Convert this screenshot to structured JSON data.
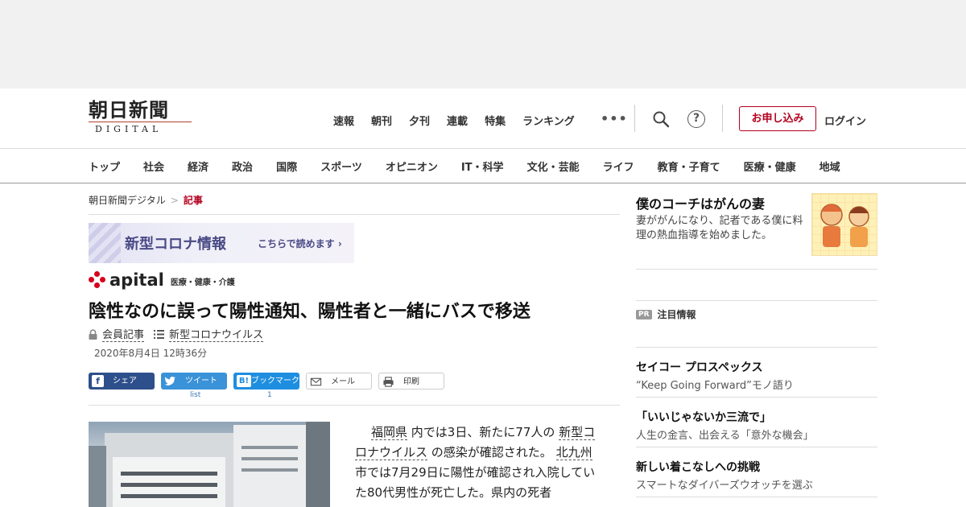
{
  "header": {
    "logo_main": "朝日新聞",
    "logo_sub": "DIGITAL",
    "nav": [
      "速報",
      "朝刊",
      "夕刊",
      "連載",
      "特集",
      "ランキング"
    ],
    "more": "•••",
    "help": "?",
    "apply_label": "お申し込み",
    "login_label": "ログイン",
    "accent_color": "#b3001e"
  },
  "categories": [
    "トップ",
    "社会",
    "経済",
    "政治",
    "国際",
    "スポーツ",
    "オピニオン",
    "IT・科学",
    "文化・芸能",
    "ライフ",
    "教育・子育て",
    "医療・健康",
    "地域"
  ],
  "breadcrumb": {
    "home": "朝日新聞デジタル",
    "sep": ">",
    "current": "記事"
  },
  "corona_banner": {
    "title": "新型コロナ情報",
    "sub": "こちらで読めます ›"
  },
  "apital": {
    "logo": "apital",
    "category": "医療・健康・介護"
  },
  "article": {
    "headline": "陰性なのに誤って陽性通知、陽性者と一緒にバスで移送",
    "tag_member": "会員記事",
    "tag_topic": "新型コロナウイルス",
    "date": "2020年8月4日 12時36分",
    "body_1": "福岡県",
    "body_2": "内では3日、新たに77人の",
    "body_3": "新型コロナウイルス",
    "body_4": "の感染が確認された。",
    "body_5": "北九州",
    "body_6": "市では7月29日に陽性が確認され入院していた80代男性が死亡した。県内の死者"
  },
  "share": {
    "facebook": "シェア",
    "twitter": "ツイート",
    "hatena": "ブックマーク",
    "hatena_icon": "B!",
    "mail": "メール",
    "print": "印刷",
    "twitter_count": "list",
    "hatena_count": "1"
  },
  "sidebar": {
    "feature_title": "僕のコーチはがんの妻",
    "feature_desc": "妻ががんになり、記者である僕に料理の熱血指導を始めました。",
    "pr_badge": "PR",
    "pr_label": "注目情報",
    "items": [
      {
        "title": "セイコー プロスペックス",
        "desc": "“Keep Going Forward”モノ語り"
      },
      {
        "title": "「いいじゃないか三流で」",
        "desc": "人生の金言、出会える「意外な機会」"
      },
      {
        "title": "新しい着こなしへの挑戦",
        "desc": "スマートなダイバーズウオッチを選ぶ"
      }
    ]
  }
}
